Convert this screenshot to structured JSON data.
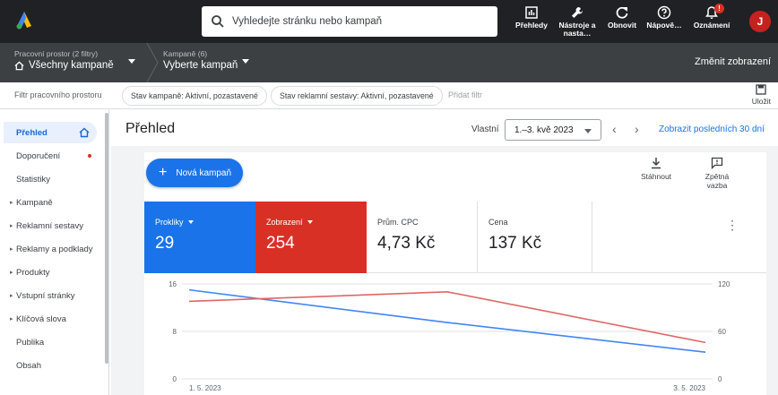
{
  "header": {
    "search_placeholder": "Vyhledejte stránku nebo kampaň",
    "buttons": [
      {
        "label": "Přehledy",
        "icon": "reports-icon"
      },
      {
        "label": "Nástroje a nasta…",
        "icon": "tools-icon"
      },
      {
        "label": "Obnovit",
        "icon": "refresh-icon"
      },
      {
        "label": "Nápově…",
        "icon": "help-icon"
      },
      {
        "label": "Oznámení",
        "icon": "bell-icon"
      }
    ],
    "notification_badge": "!",
    "avatar": "J"
  },
  "breadcrumb": {
    "workspace_sub": "Pracovní prostor (2 filtry)",
    "workspace_main": "Všechny kampaně",
    "campaign_sub": "Kampaně (6)",
    "campaign_main": "Vyberte kampaň",
    "change_view": "Změnit zobrazení"
  },
  "filters": {
    "label": "Filtr pracovního prostoru",
    "chips": [
      "Stav kampaně: Aktivní, pozastavené",
      "Stav reklamní sestavy: Aktivní, pozastavené"
    ],
    "add": "Přidat filtr",
    "save": "Uložit"
  },
  "sidebar": {
    "items": [
      {
        "label": "Přehled",
        "active": true
      },
      {
        "label": "Doporučení",
        "dot": true
      },
      {
        "label": "Statistiky"
      },
      {
        "label": "Kampaně",
        "expandable": true
      },
      {
        "label": "Reklamní sestavy",
        "expandable": true
      },
      {
        "label": "Reklamy a podklady",
        "expandable": true
      },
      {
        "label": "Produkty",
        "expandable": true
      },
      {
        "label": "Vstupní stránky",
        "expandable": true
      },
      {
        "label": "Klíčová slova",
        "expandable": true
      },
      {
        "label": "Publika"
      },
      {
        "label": "Obsah"
      }
    ]
  },
  "main": {
    "title": "Přehled",
    "range_label": "Vlastní",
    "date_range": "1.–3. kvě 2023",
    "last30": "Zobrazit posledních 30 dní",
    "new_campaign": "Nová kampaň",
    "download": "Stáhnout",
    "feedback": "Zpětná vazba"
  },
  "metrics": [
    {
      "label": "Prokliky",
      "value": "29",
      "color": "#1a73e8",
      "selected": true
    },
    {
      "label": "Zobrazení",
      "value": "254",
      "color": "#d93025",
      "selected": true
    },
    {
      "label": "Prům. CPC",
      "value": "4,73 Kč"
    },
    {
      "label": "Cena",
      "value": "137 Kč"
    }
  ],
  "chart_data": {
    "type": "line",
    "categories": [
      "1. 5. 2023",
      "",
      "3. 5. 2023"
    ],
    "series": [
      {
        "name": "Prokliky",
        "axis": "left",
        "color": "#4285f4",
        "values": [
          15,
          9.5,
          4.5
        ]
      },
      {
        "name": "Zobrazení",
        "axis": "right",
        "color": "#e06666",
        "values": [
          98,
          110,
          46
        ]
      }
    ],
    "y_left": {
      "ticks": [
        0,
        8,
        16
      ],
      "range": [
        0,
        16
      ]
    },
    "y_right": {
      "ticks": [
        0,
        60,
        120
      ],
      "range": [
        0,
        120
      ]
    },
    "grid": true
  }
}
